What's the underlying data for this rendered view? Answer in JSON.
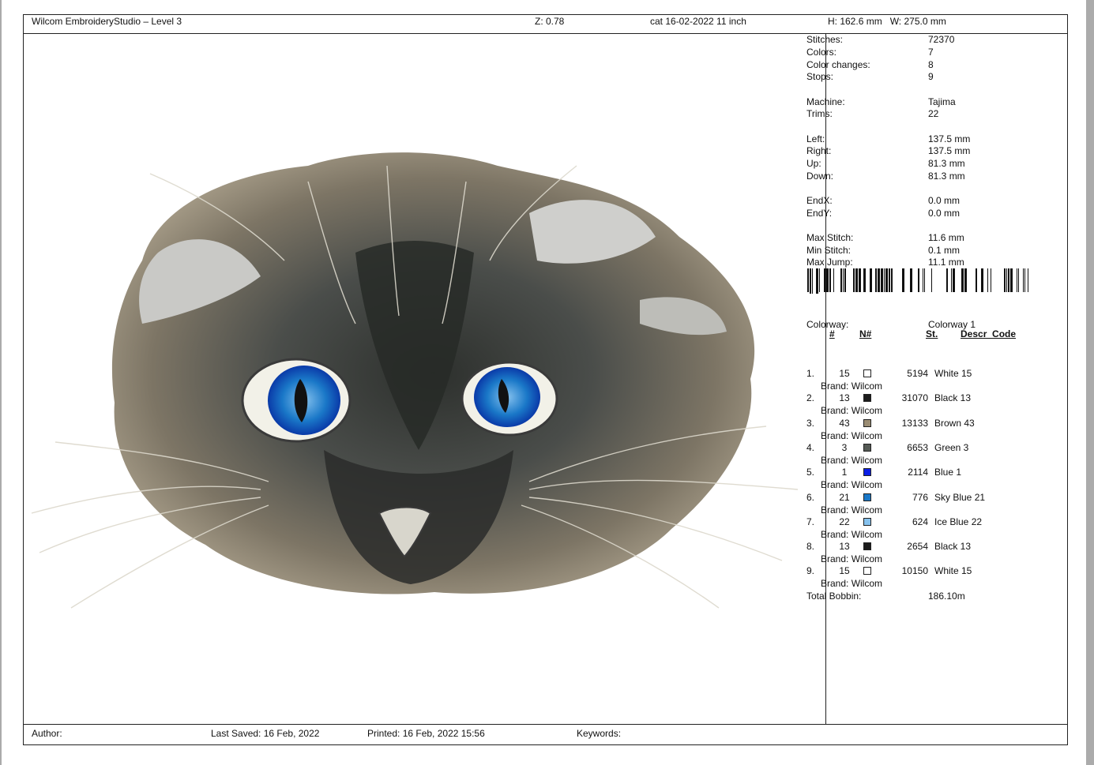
{
  "header": {
    "app_title": "Wilcom EmbroideryStudio – Level 3",
    "zoom": "Z: 0.78",
    "design_name": "cat 16-02-2022 11 inch",
    "dimensions": "H: 162.6 mm   W: 275.0 mm"
  },
  "stats": [
    {
      "label": "Stitches:",
      "value": "72370"
    },
    {
      "label": "Colors:",
      "value": "7"
    },
    {
      "label": "Color changes:",
      "value": "8"
    },
    {
      "label": "Stops:",
      "value": "9"
    },
    {
      "label": "Machine:",
      "value": "Tajima"
    },
    {
      "label": "Trims:",
      "value": "22"
    },
    {
      "label": "Left:",
      "value": "137.5 mm"
    },
    {
      "label": "Right:",
      "value": "137.5 mm"
    },
    {
      "label": "Up:",
      "value": "81.3 mm"
    },
    {
      "label": "Down:",
      "value": "81.3 mm"
    },
    {
      "label": "EndX:",
      "value": "0.0 mm"
    },
    {
      "label": "EndY:",
      "value": "0.0 mm"
    },
    {
      "label": "Max Stitch:",
      "value": "11.6 mm"
    },
    {
      "label": "Min Stitch:",
      "value": "0.1 mm"
    },
    {
      "label": "Max Jump:",
      "value": "11.1 mm"
    }
  ],
  "colorway": {
    "label": "Colorway:",
    "value": "Colorway 1"
  },
  "color_table": {
    "headers": {
      "num": "#",
      "n": "N#",
      "st": "St.",
      "desc": "Descr_Code"
    },
    "brand_label": "Brand: Wilcom",
    "rows": [
      {
        "num": "1.",
        "n": "15",
        "color": "#ffffff",
        "st": "5194",
        "desc": "White 15"
      },
      {
        "num": "2.",
        "n": "13",
        "color": "#1c1c1c",
        "st": "31070",
        "desc": "Black 13"
      },
      {
        "num": "3.",
        "n": "43",
        "color": "#9a8c73",
        "st": "13133",
        "desc": "Brown 43"
      },
      {
        "num": "4.",
        "n": "3",
        "color": "#555a55",
        "st": "6653",
        "desc": "Green 3"
      },
      {
        "num": "5.",
        "n": "1",
        "color": "#0a1ee6",
        "st": "2114",
        "desc": "Blue 1"
      },
      {
        "num": "6.",
        "n": "21",
        "color": "#1a78c8",
        "st": "776",
        "desc": "Sky Blue 21"
      },
      {
        "num": "7.",
        "n": "22",
        "color": "#86c2ee",
        "st": "624",
        "desc": "Ice Blue 22"
      },
      {
        "num": "8.",
        "n": "13",
        "color": "#1c1c1c",
        "st": "2654",
        "desc": "Black 13"
      },
      {
        "num": "9.",
        "n": "15",
        "color": "#ffffff",
        "st": "10150",
        "desc": "White 15"
      }
    ],
    "total_label": "Total Bobbin:",
    "total_value": "186.10m"
  },
  "footer": {
    "author": "Author:",
    "last_saved": "Last Saved: 16 Feb, 2022",
    "printed": "Printed: 16 Feb, 2022 15:56",
    "keywords": "Keywords:"
  }
}
